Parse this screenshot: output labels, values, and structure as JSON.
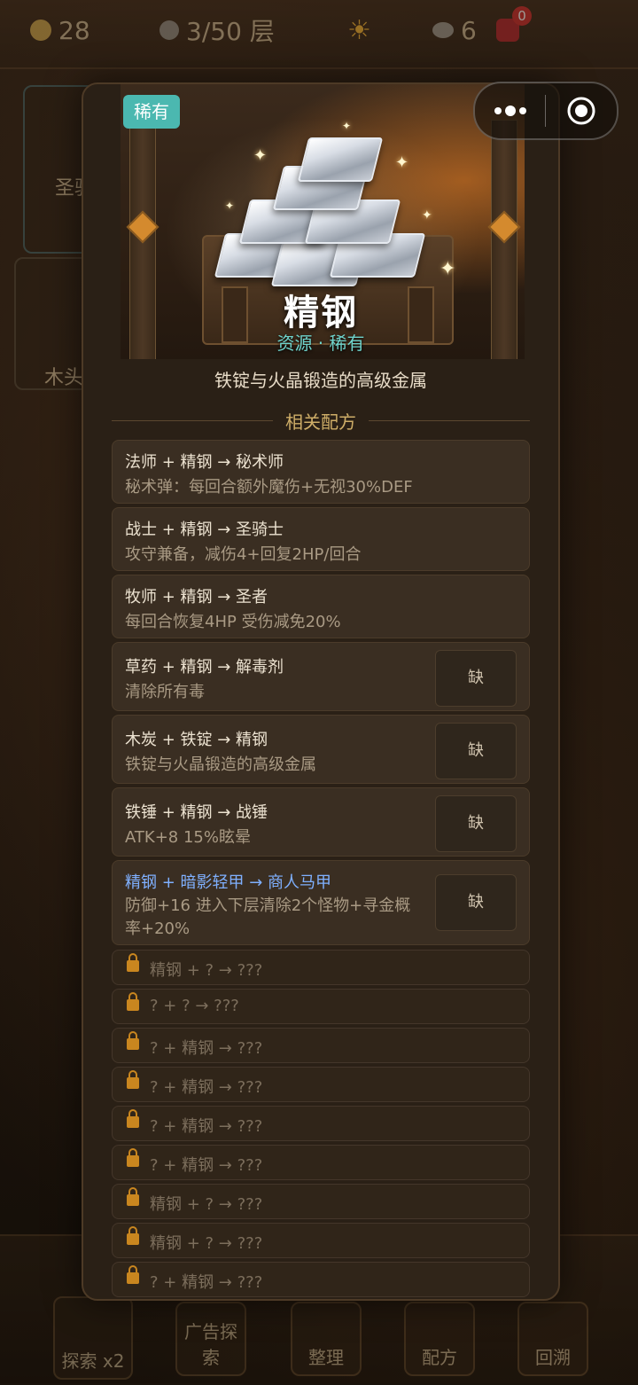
{
  "topbar": {
    "coins": "28",
    "floor": "3/50 层",
    "stones": "6",
    "bag_badge": "0"
  },
  "background_cards": [
    {
      "label": "圣骑"
    },
    {
      "label": "木头"
    }
  ],
  "bottom_nav": [
    {
      "label": "探索 x2"
    },
    {
      "label": "广告探索"
    },
    {
      "label": "整理"
    },
    {
      "label": "配方"
    },
    {
      "label": "回溯"
    }
  ],
  "item": {
    "rarity_tag": "稀有",
    "name": "精钢",
    "subtitle": "资源 · 稀有",
    "description": "铁锭与火晶锻造的高级金属",
    "rarity_color": "#4bb8b0"
  },
  "recipes_section_title": "相关配方",
  "recipes": [
    {
      "title": "法师 + 精钢 → 秘术师",
      "desc": "秘术弹：每回合额外魔伤+无视30%DEF"
    },
    {
      "title": "战士 + 精钢 → 圣骑士",
      "desc": "攻守兼备，减伤4+回复2HP/回合"
    },
    {
      "title": "牧师 + 精钢 → 圣者",
      "desc": "每回合恢复4HP 受伤减免20%"
    },
    {
      "title": "草药 + 精钢 → 解毒剂",
      "desc": "清除所有毒",
      "need": "缺"
    },
    {
      "title": "木炭 + 铁锭 → 精钢",
      "desc": "铁锭与火晶锻造的高级金属",
      "need": "缺"
    },
    {
      "title": "铁锤 + 精钢 → 战锤",
      "desc": "ATK+8 15%眩晕",
      "need": "缺"
    },
    {
      "title": "精钢 + 暗影轻甲 → 商人马甲",
      "desc_line1": "防御+16 进入下层清除2个怪物+寻金概",
      "desc_line2": "率+20%",
      "need": "缺"
    }
  ],
  "locked_recipes": [
    "精钢 + ? → ???",
    "? + ? → ???",
    "? + 精钢 → ???",
    "? + 精钢 → ???",
    "? + 精钢 → ???",
    "? + 精钢 → ???",
    "精钢 + ? → ???",
    "精钢 + ? → ???",
    "? + 精钢 → ???"
  ]
}
